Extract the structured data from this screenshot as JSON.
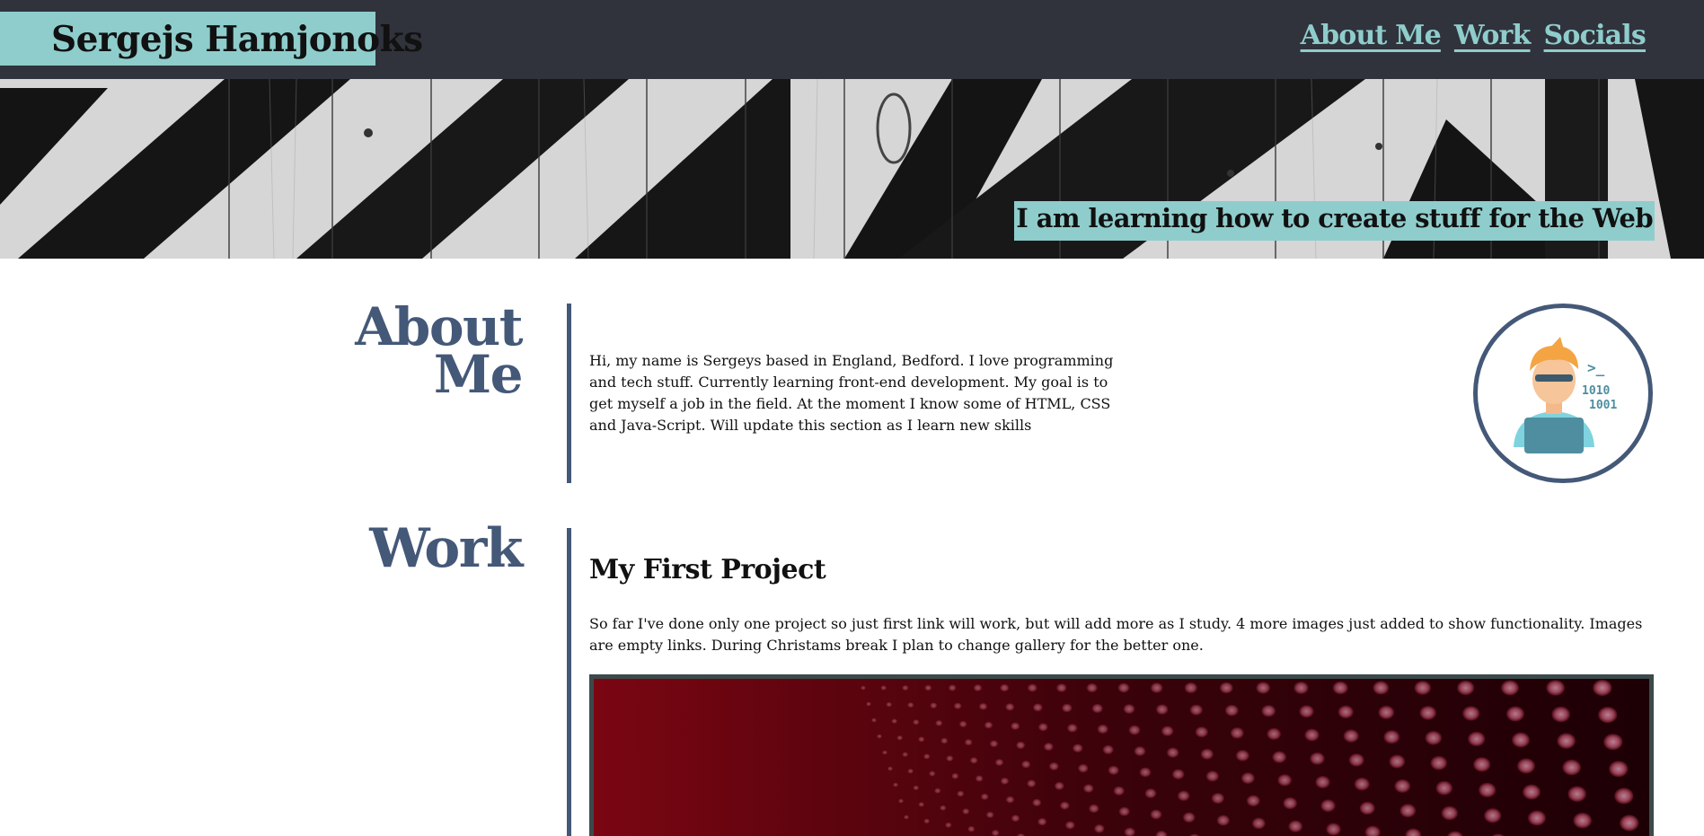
{
  "header": {
    "brand_name": "Sergejs Hamjonoks",
    "nav": [
      {
        "label": "About Me"
      },
      {
        "label": "Work"
      },
      {
        "label": "Socials"
      }
    ]
  },
  "hero": {
    "tagline": "I am learning how to create stuff for the Web"
  },
  "about": {
    "title_line1": "About",
    "title_line2": "Me",
    "text": "Hi, my name is Sergeys based in England, Bedford. I love programming and tech stuff. Currently learning front-end development. My goal is to get myself a job in the field. At the moment I know some of HTML, CSS and Java-Script. Will update this section as I learn new skills",
    "avatar_code_text": ">_",
    "avatar_binary_1": "1010",
    "avatar_binary_2": "1001"
  },
  "work": {
    "title": "Work",
    "project_title": "My First Project",
    "text": "So far I've done only one project so just first link will work, but will add more as I study. 4 more images just added to show functionality. Images are empty links. During Christams break I plan to change gallery for the better one."
  },
  "colors": {
    "header_bg": "#30333c",
    "accent": "#8fcdcc",
    "heading": "#445878",
    "text": "#111111"
  }
}
